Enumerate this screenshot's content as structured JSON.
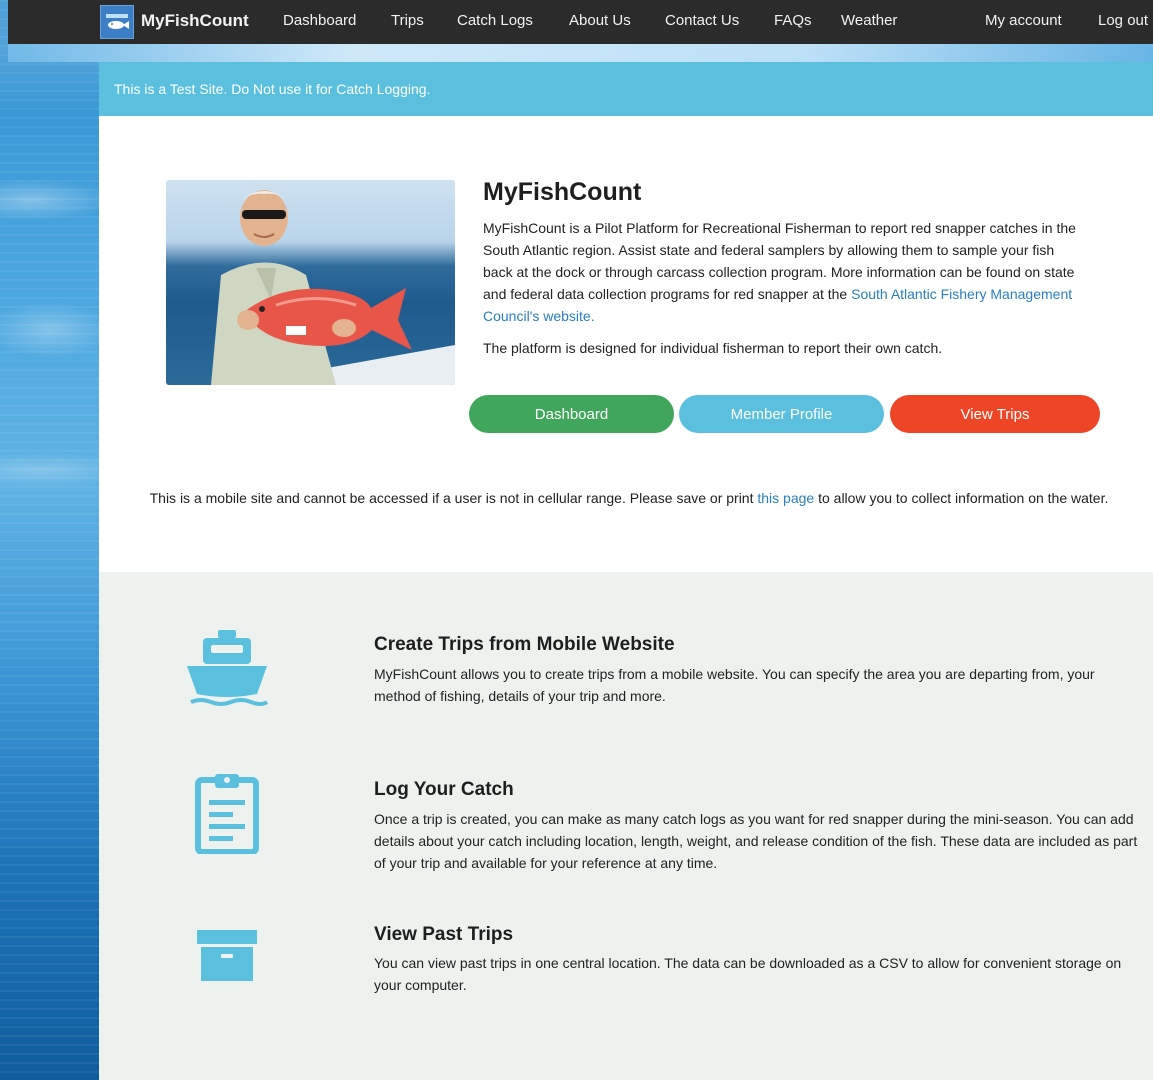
{
  "nav": {
    "brand": "MyFishCount",
    "links": [
      "Dashboard",
      "Trips",
      "Catch Logs",
      "About Us",
      "Contact Us",
      "FAQs",
      "Weather"
    ],
    "account": "My account",
    "logout": "Log out"
  },
  "alert": {
    "text": "This is a Test Site. Do Not use it for Catch Logging."
  },
  "hero": {
    "title": "MyFishCount",
    "desc_text": "MyFishCount is a Pilot Platform for Recreational Fisherman to report red snapper catches in the South Atlantic region. Assist state and federal samplers by allowing them to sample your fish back at the dock or through carcass collection program. More information can be found on state and federal data collection programs for red snapper at the ",
    "desc_link": "South Atlantic Fishery Management Council's website.",
    "note": "The platform is designed for individual fisherman to report their own catch.",
    "buttons": {
      "dashboard": "Dashboard",
      "member_profile": "Member Profile",
      "view_trips": "View Trips"
    }
  },
  "mobile_note": {
    "before": "This is a mobile site and cannot be accessed if a user is not in cellular range. Please save or print ",
    "link": "this page",
    "after": " to allow you to collect information on the water."
  },
  "features": [
    {
      "icon": "boat-icon",
      "title": "Create Trips from Mobile Website",
      "text": "MyFishCount allows you to create trips from a mobile website. You can specify the area you are departing from, your method of fishing, details of your trip and more."
    },
    {
      "icon": "clipboard-icon",
      "title": "Log Your Catch",
      "text": "Once a trip is created, you can make as many catch logs as you want for red snapper during the mini-season. You can add details about your catch including location, length, weight, and release condition of the fish. These data are included as part of your trip and available for your reference at any time."
    },
    {
      "icon": "archive-box-icon",
      "title": "View Past Trips",
      "text": "You can view past trips in one central location. The data can be downloaded as a CSV to allow for convenient storage on your computer."
    }
  ],
  "colors": {
    "nav_bg": "#2b2b2b",
    "alert_bg": "#5bc0de",
    "green": "#3fa65c",
    "blue": "#5bc0de",
    "red": "#ee4527",
    "icon": "#5bc0de"
  }
}
